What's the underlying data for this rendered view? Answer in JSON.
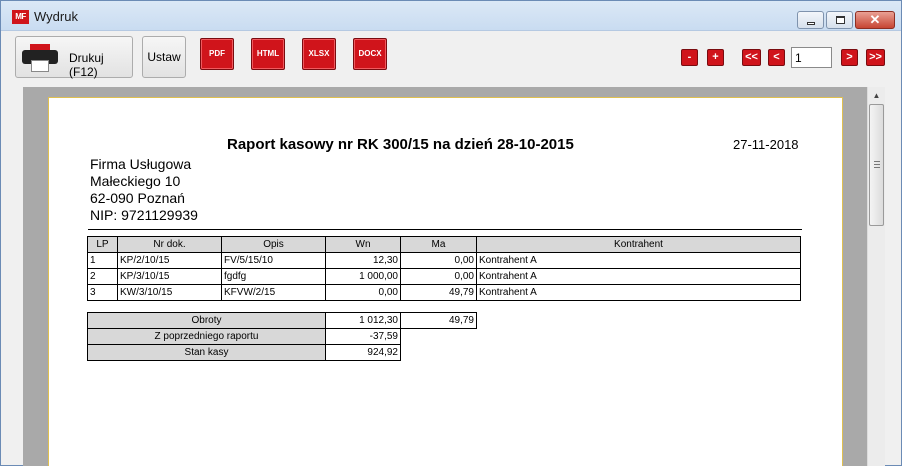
{
  "window": {
    "logo_text": "MF",
    "title": "Wydruk",
    "close_glyph": "✕"
  },
  "toolbar": {
    "print_label": "Drukuj (F12)",
    "setup_label": "Ustaw",
    "exports": [
      "PDF",
      "HTML",
      "XLSX",
      "DOCX"
    ],
    "nav": {
      "minus": "-",
      "plus": "+",
      "first": "<<",
      "prev": "<",
      "page": "1",
      "next": ">",
      "last": ">>"
    }
  },
  "report": {
    "title": "Raport kasowy nr RK 300/15 na dzień 28-10-2015",
    "date": "27-11-2018",
    "company": [
      "Firma Usługowa",
      "Małeckiego 10",
      "62-090 Poznań",
      "NIP: 9721129939"
    ],
    "columns": [
      "LP",
      "Nr dok.",
      "Opis",
      "Wn",
      "Ma",
      "Kontrahent"
    ],
    "rows": [
      [
        "1",
        "KP/2/10/15",
        "FV/5/15/10",
        "12,30",
        "0,00",
        "Kontrahent A"
      ],
      [
        "2",
        "KP/3/10/15",
        "fgdfg",
        "1 000,00",
        "0,00",
        "Kontrahent A"
      ],
      [
        "3",
        "KW/3/10/15",
        "KFVW/2/15",
        "0,00",
        "49,79",
        "Kontrahent A"
      ]
    ],
    "summary": {
      "turnover_label": "Obroty",
      "turnover_wn": "1 012,30",
      "turnover_ma": "49,79",
      "previous_label": "Z poprzedniego raportu",
      "previous_value": "-37,59",
      "balance_label": "Stan kasy",
      "balance_value": "924,92"
    }
  },
  "colors": {
    "accent": "#d0141b",
    "page_border": "#e0c050",
    "preview_bg": "#a9a9a9"
  }
}
